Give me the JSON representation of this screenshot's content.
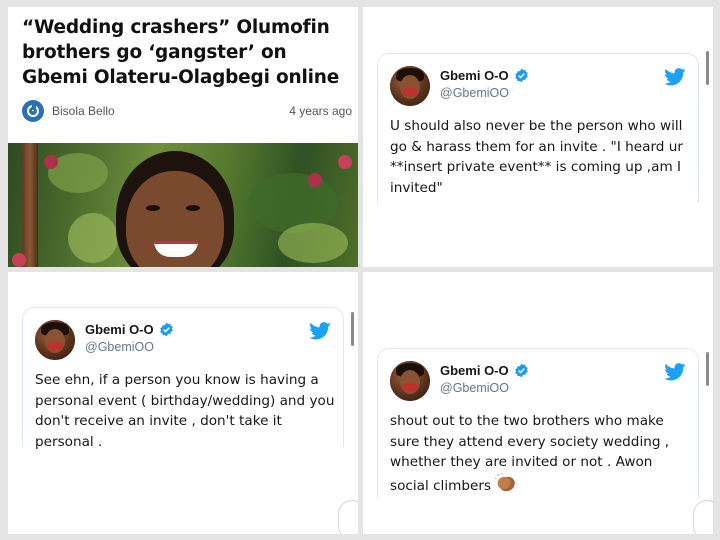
{
  "article": {
    "headline": "“Wedding crashers” Olumofin brothers go ‘gangster’ on Gbemi Olateru-Olagbegi online",
    "author": "Bisola Bello",
    "time_ago": "4 years ago"
  },
  "tweets": [
    {
      "display_name": "Gbemi O-O",
      "handle": "@GbemiOO",
      "text": "U should also never be the person who will go & harass them for an invite . \"I heard ur **insert private event** is coming up ,am I invited\""
    },
    {
      "display_name": "Gbemi O-O",
      "handle": "@GbemiOO",
      "text": "See ehn, if a person you know is having a personal event ( birthday/wedding) and you don't receive an invite , don't take it personal ."
    },
    {
      "display_name": "Gbemi O-O",
      "handle": "@GbemiOO",
      "text": "shout out to the two brothers who make sure they attend every society wedding , whether they are invited or not . Awon social climbers",
      "emoji": "clapping-hands-icon"
    }
  ],
  "colors": {
    "twitter_blue": "#1da1f2",
    "verified_blue": "#1d9bf0",
    "handle_gray": "#657786",
    "author_icon_blue": "#2b6fb6"
  }
}
